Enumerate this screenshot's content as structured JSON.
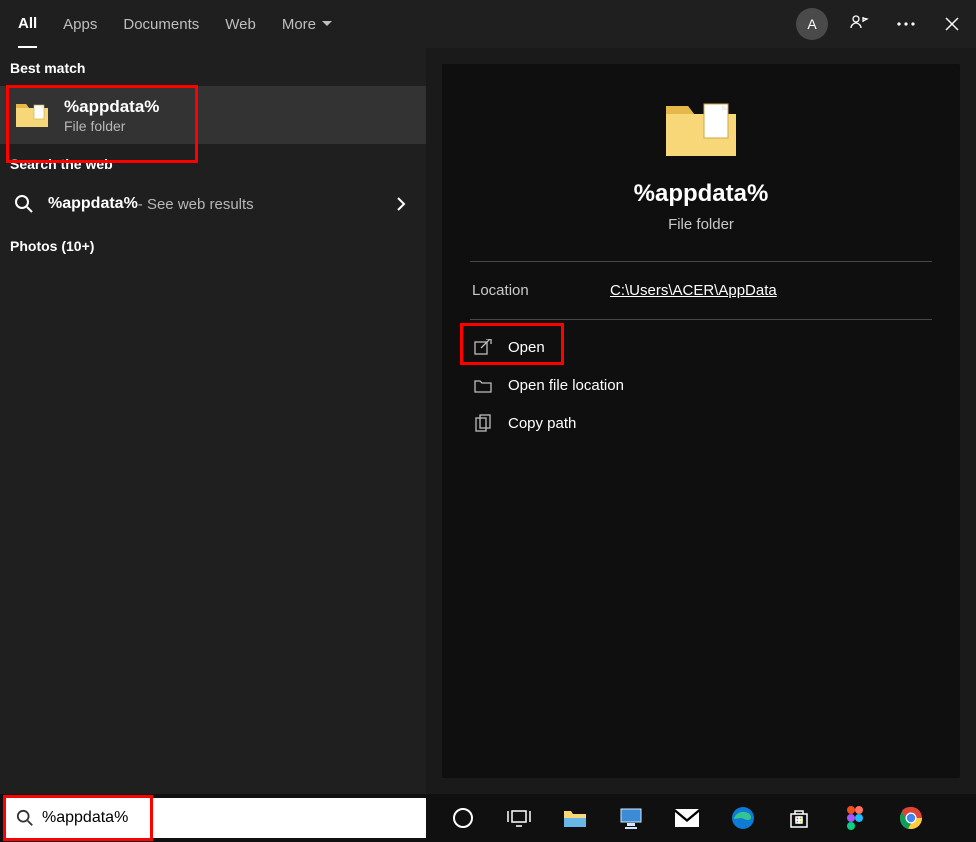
{
  "header": {
    "tabs": {
      "all": "All",
      "apps": "Apps",
      "documents": "Documents",
      "web": "Web",
      "more": "More"
    },
    "avatar_letter": "A"
  },
  "left": {
    "best_match_label": "Best match",
    "result": {
      "title": "%appdata%",
      "subtitle": "File folder"
    },
    "web_label": "Search the web",
    "web_query": "%appdata%",
    "web_suffix": " - See web results",
    "photos_label": "Photos (10+)"
  },
  "detail": {
    "title": "%appdata%",
    "subtitle": "File folder",
    "location_label": "Location",
    "location_value": "C:\\Users\\ACER\\AppData",
    "actions": {
      "open": "Open",
      "open_location": "Open file location",
      "copy_path": "Copy path"
    }
  },
  "taskbar": {
    "search_value": "%appdata%"
  }
}
